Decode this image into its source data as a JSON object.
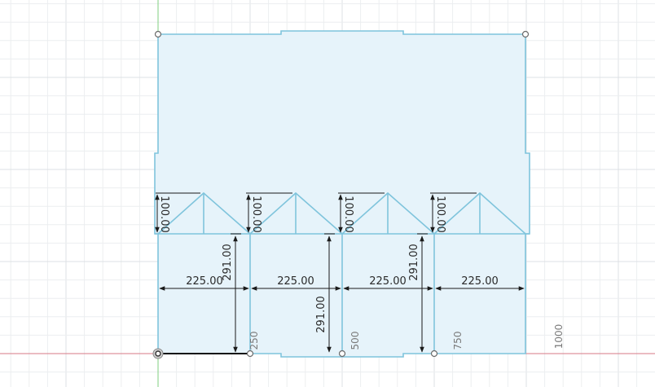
{
  "sketch": {
    "fill_color": "#e6f3fa",
    "line_color": "#7fc4dc",
    "x_axis_color": "#d77a86",
    "y_axis_color": "#7fcf7f",
    "dimensions": {
      "triangle_heights": [
        "100.00",
        "100.00",
        "100.00",
        "100.00"
      ],
      "spacing_widths": [
        "225.00",
        "225.00",
        "225.00",
        "225.00"
      ],
      "vertical_heights": [
        "291.00",
        "291.00",
        "291.00"
      ]
    },
    "axis_ticks": [
      "250",
      "500",
      "750",
      "1000"
    ]
  }
}
